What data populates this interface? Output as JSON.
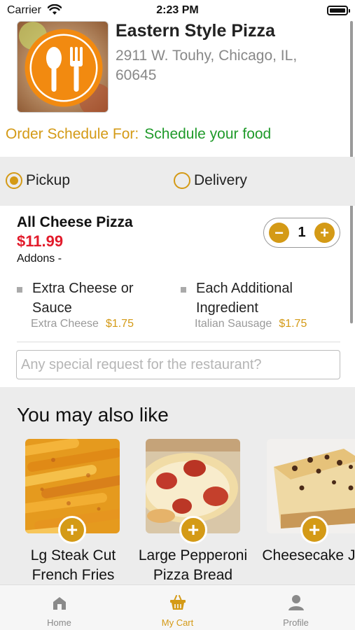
{
  "status_bar": {
    "carrier": "Carrier",
    "time": "2:23 PM"
  },
  "restaurant": {
    "name": "Eastern Style Pizza",
    "address": "2911 W. Touhy, Chicago, IL, 60645"
  },
  "schedule": {
    "label": "Order Schedule For:",
    "value": "Schedule your food"
  },
  "order_type": {
    "selected": "Pickup",
    "options": [
      "Pickup",
      "Delivery"
    ]
  },
  "cart_item": {
    "name": "All Cheese Pizza",
    "price": "$11.99",
    "quantity": "1",
    "addons_label": "Addons -",
    "addons": [
      {
        "name": "Extra Cheese or Sauce",
        "option": "Extra Cheese",
        "price": "$1.75"
      },
      {
        "name": "Each Additional Ingredient",
        "option": "Italian Sausage",
        "price": "$1.75"
      }
    ]
  },
  "special_request": {
    "placeholder": "Any special request for the restaurant?",
    "value": ""
  },
  "suggestions": {
    "title": "You may also like",
    "items": [
      {
        "name": "Lg Steak Cut French Fries"
      },
      {
        "name": "Large Pepperoni Pizza Bread"
      },
      {
        "name": "Cheesecake JR"
      }
    ]
  },
  "tabbar": {
    "active": "My Cart",
    "items": [
      {
        "label": "Home",
        "icon": "home-icon"
      },
      {
        "label": "My Cart",
        "icon": "basket-icon"
      },
      {
        "label": "Profile",
        "icon": "person-icon"
      }
    ]
  },
  "colors": {
    "accent": "#d49a16",
    "price": "#e21b2b",
    "schedule_value": "#1f9a2a"
  }
}
